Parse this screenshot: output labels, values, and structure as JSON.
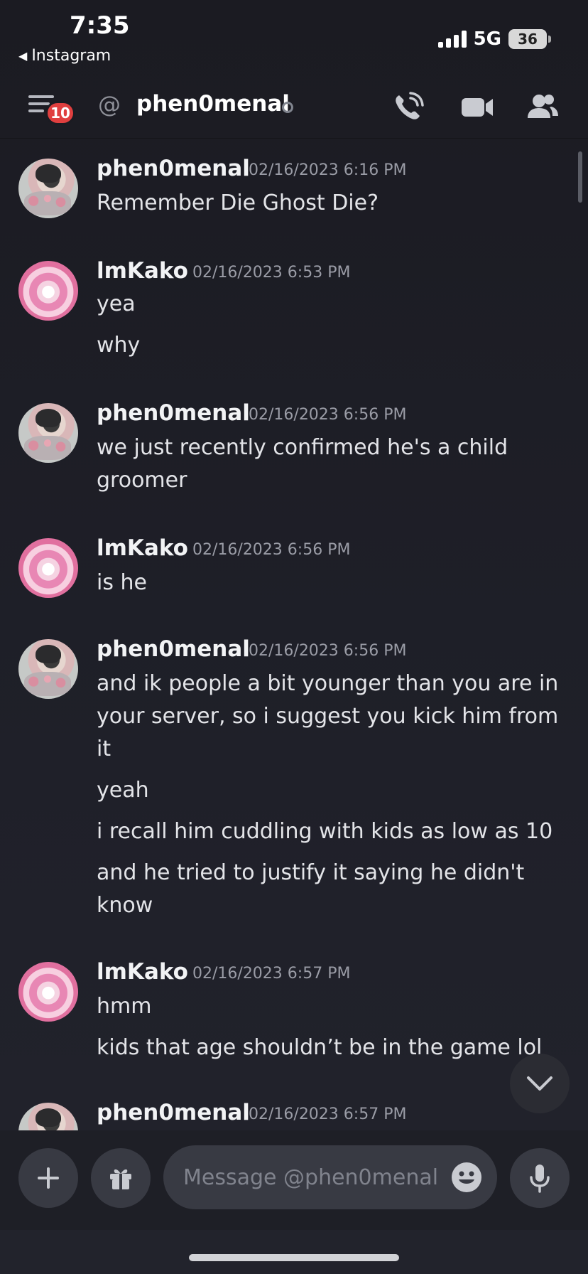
{
  "status_bar": {
    "time": "7:35",
    "back_app": "Instagram",
    "network": "5G",
    "battery": "36"
  },
  "header": {
    "badge_count": "10",
    "channel_name": "phen0menal"
  },
  "messages": [
    {
      "author": "phen0menal",
      "timestamp": "02/16/2023 6:16 PM",
      "lines": [
        "Remember Die Ghost Die?"
      ]
    },
    {
      "author": "lmKako",
      "timestamp": "02/16/2023 6:53 PM",
      "lines": [
        "yea",
        "why"
      ]
    },
    {
      "author": "phen0menal",
      "timestamp": "02/16/2023 6:56 PM",
      "lines": [
        "we just recently confirmed he's a child",
        "groomer"
      ]
    },
    {
      "author": "lmKako",
      "timestamp": "02/16/2023 6:56 PM",
      "lines": [
        "is he"
      ]
    },
    {
      "author": "phen0menal",
      "timestamp": "02/16/2023 6:56 PM",
      "lines": [
        "and ik people a bit younger than you are in",
        "your server, so i suggest you kick him from",
        "it",
        "yeah",
        "i recall him cuddling with kids as low as 10",
        "and he tried to justify it saying he didn't",
        "know"
      ]
    },
    {
      "author": "lmKako",
      "timestamp": "02/16/2023 6:57 PM",
      "lines": [
        "hmm",
        "kids that age shouldn’t be in the game lol"
      ]
    },
    {
      "author": "phen0menal",
      "timestamp": "02/16/2023 6:57 PM",
      "lines": []
    }
  ],
  "composer": {
    "placeholder": "Message @phen0menal"
  }
}
